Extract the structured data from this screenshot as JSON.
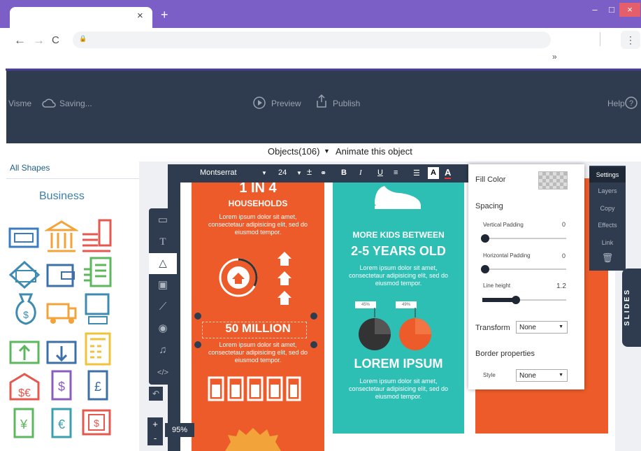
{
  "browser": {
    "close_tab": "×",
    "new_tab": "+",
    "back": "←",
    "forward": "→",
    "reload": "C",
    "lock": "🔒",
    "menu": "⋮",
    "extensions": "»",
    "min": "–",
    "max": "□",
    "close": "×"
  },
  "header": {
    "logo": "Visme",
    "status": "Saving...",
    "preview": "Preview",
    "publish": "Publish",
    "help": "Help"
  },
  "objects_bar": {
    "objects": "Objects(106)",
    "animate": "Animate this object"
  },
  "left_panel": {
    "all_shapes": "All Shapes",
    "category": "Business"
  },
  "text_toolbar": {
    "font": "Montserrat",
    "size": "24",
    "bold": "B",
    "italic": "I",
    "underline": "U"
  },
  "slide": {
    "col1": {
      "title": "1 IN 4",
      "subtitle": "HOUSEHOLDS",
      "body1": "Lorem ipsum dolor sit amet, consectetaur adipisicing elit, sed do eiusmod tempor.",
      "big": "50 MILLION",
      "body2": "Lorem ipsum dolor sit amet, consectetaur adipisicing elit, sed do eiusmod tempor."
    },
    "col2": {
      "kicker": "MORE KIDS BETWEEN",
      "title": "2-5 YEARS OLD",
      "body1": "Lorem ipsum dolor sit amet, consectetaur adipisicing elit, sed do eiusmod tempor.",
      "pie1": "45%",
      "pie2": "49%",
      "big": "LOREM IPSUM",
      "body2": "Lorem ipsum dolor sit amet, consectetaur adipisicing elit, sed do eiusmod tempor."
    }
  },
  "settings": {
    "fill_color": "Fill Color",
    "spacing": "Spacing",
    "vertical_padding": "Vertical Padding",
    "vertical_padding_value": "0",
    "horizontal_padding": "Horizontal Padding",
    "horizontal_padding_value": "0",
    "line_height": "Line height",
    "line_height_value": "1.2",
    "line_height_fraction": 0.4,
    "transform": "Transform",
    "transform_value": "None",
    "border": "Border properties",
    "style": "Style",
    "style_value": "None"
  },
  "side_tabs": [
    "Settings",
    "Layers",
    "Copy",
    "Effects",
    "Link"
  ],
  "slides_label": "SLIDES",
  "zoom": {
    "plus": "+",
    "minus": "-",
    "value": "95%"
  },
  "colors": {
    "purple": "#7b5fc6",
    "dark": "#2f3c4f",
    "orange": "#ed5b2a",
    "teal": "#2ebfb4"
  }
}
